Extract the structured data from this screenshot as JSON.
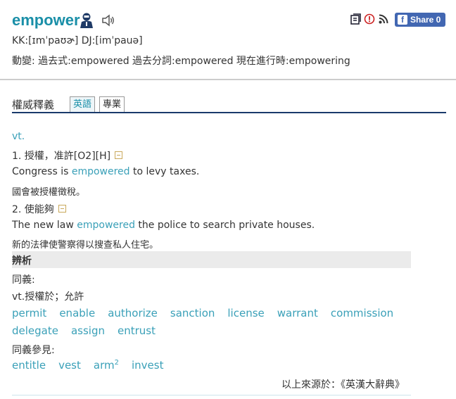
{
  "header": {
    "headword": "empower",
    "phonetic": "KK:[ɪmˈpaʊɚ] DJ:[imˈpauə]",
    "forms": "動變: 過去式:empowered  過去分詞:empowered  現在進行時:empowering",
    "share_label": "Share 0",
    "icons": [
      "user-pronounce-icon",
      "speaker-icon",
      "wordbook-icon",
      "report-icon",
      "rss-icon",
      "facebook-icon"
    ]
  },
  "section": {
    "title": "權威釋義",
    "tabs": [
      {
        "label": "英語",
        "active": true
      },
      {
        "label": "專業",
        "active": false
      }
    ]
  },
  "entry": {
    "pos": "vt.",
    "senses": [
      {
        "head": "1. 授權，准許[O2][H]",
        "example_pre": "Congress is ",
        "example_word": "empowered",
        "example_post": " to levy taxes.",
        "translation": "國會被授權徵稅。"
      },
      {
        "head": "2. 使能夠",
        "example_pre": "The new law ",
        "example_word": "empowered",
        "example_post": " the police to search private houses.",
        "translation": "新的法律使警察得以搜查私人住宅。"
      }
    ]
  },
  "analysis": {
    "title": "辨析",
    "synonyms_label": "同義:",
    "synonyms_sense": "vt.授權於；允許",
    "synonyms_row1": [
      "permit",
      "enable",
      "authorize",
      "sanction",
      "license",
      "warrant",
      "commission"
    ],
    "synonyms_row2": [
      "delegate",
      "assign",
      "entrust"
    ],
    "see_also_label": "同義參見:",
    "see_also": [
      "entitle",
      "vest",
      "arm",
      "invest"
    ],
    "arm_sup": "2"
  },
  "source": "以上來源於：《英漢大辭典》",
  "colors": {
    "accent": "#1a8fa8",
    "link": "#3aa0b8",
    "rule": "#1a3a6b",
    "facebook": "#4267b2"
  }
}
